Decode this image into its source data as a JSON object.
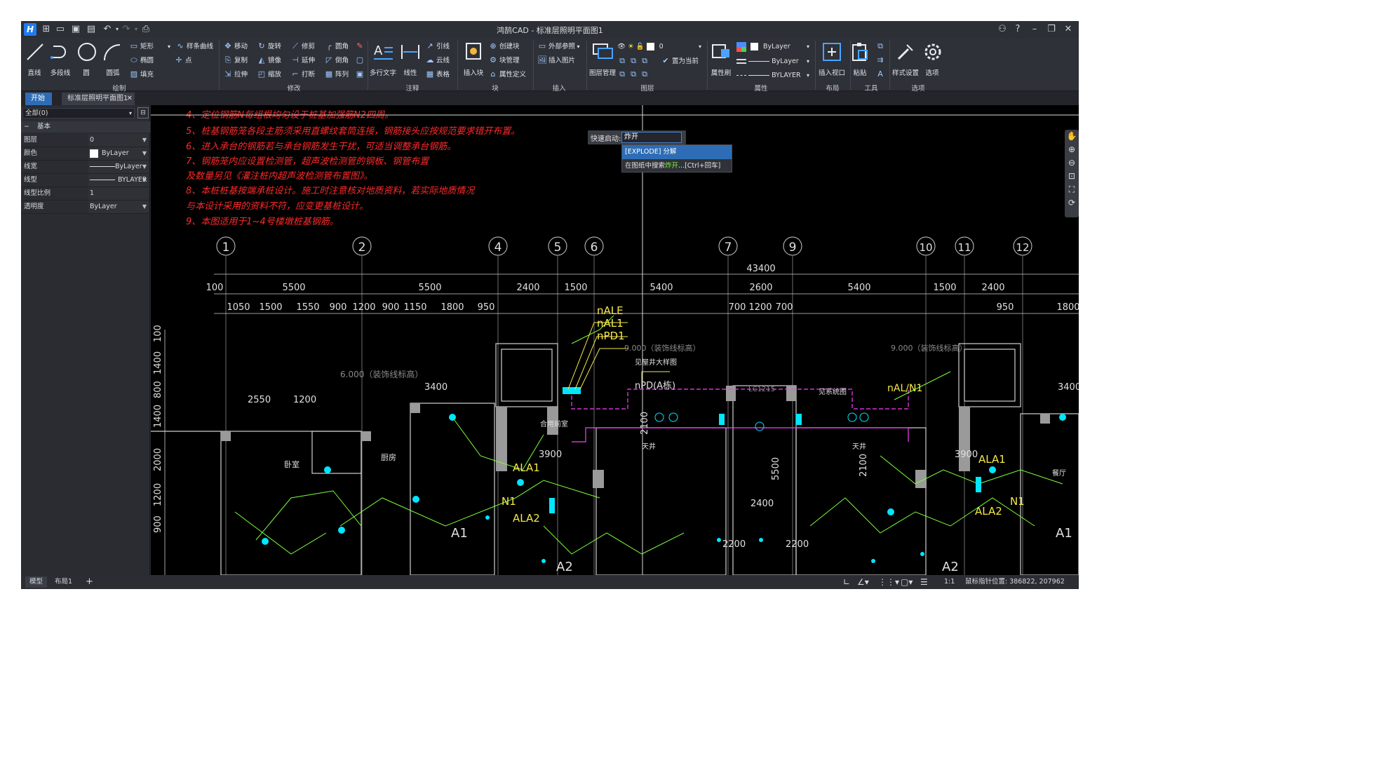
{
  "titlebar": {
    "title": "鸿鹄CAD - 标准层照明平面图1",
    "logo": "H",
    "qat_icons": [
      "new-icon",
      "open-icon",
      "save-icon",
      "save-as-icon",
      "undo-icon",
      "redo-icon",
      "print-icon"
    ]
  },
  "ribbon": {
    "draw": {
      "label": "绘制",
      "line": "直线",
      "polyline": "多段线",
      "circle": "圆",
      "arc": "圆弧",
      "rect": "矩形",
      "ellipse": "椭圆",
      "hatch": "填充",
      "spline": "样条曲线",
      "point": "点"
    },
    "modify": {
      "label": "修改",
      "move": "移动",
      "rotate": "旋转",
      "trim": "修剪",
      "fillet": "圆角",
      "copy": "复制",
      "mirror": "镜像",
      "extend": "延伸",
      "chamfer": "倒角",
      "stretch": "拉伸",
      "scale": "缩放",
      "break": "打断",
      "array": "阵列"
    },
    "annotate": {
      "label": "注释",
      "mtext": "多行文字",
      "dim": "线性",
      "leader": "引线",
      "revcloud": "云线",
      "table": "表格"
    },
    "block": {
      "label": "块",
      "insert": "插入块",
      "create": "创建块",
      "manage": "块管理",
      "attdef": "属性定义"
    },
    "insert": {
      "label": "插入",
      "xref": "外部参照",
      "image": "插入图片"
    },
    "layer": {
      "label": "图层",
      "manager": "图层管理",
      "current": "0",
      "set_current": "置为当前"
    },
    "properties": {
      "label": "属性",
      "match": "属性刷",
      "color": "ByLayer",
      "lineweight": "ByLayer",
      "linetype": "BYLAYER"
    },
    "layout": {
      "label": "布局",
      "viewport": "插入视口"
    },
    "tools": {
      "label": "工具",
      "paste": "粘贴"
    },
    "options": {
      "label": "选项",
      "style": "样式设置",
      "options": "选项"
    }
  },
  "tabs": {
    "home": "开始",
    "doc": "标准层照明平面图1"
  },
  "left_panel": {
    "selector": "全部(0)",
    "section": "基本",
    "rows": [
      {
        "key": "图层",
        "value": "0"
      },
      {
        "key": "颜色",
        "value": "ByLayer"
      },
      {
        "key": "线宽",
        "value": "ByLayer"
      },
      {
        "key": "线型",
        "value": "BYLAYER"
      },
      {
        "key": "线型比例",
        "value": "1"
      },
      {
        "key": "透明度",
        "value": "ByLayer"
      }
    ]
  },
  "quick_launch": {
    "label": "快速启动:",
    "input": "炸开",
    "suggestion": "[EXPLODE] 分解",
    "search_prefix": "在图纸中搜索",
    "search_term": "炸开",
    "search_suffix": "...[Ctrl+回车]"
  },
  "drawing": {
    "notes": [
      "4、定位钢筋N每组根均匀设于桩基加强筋N2四周。",
      "5、桩基钢筋笼各段主筋须采用直螺纹套筒连接，钢筋接头应按规范要求错开布置。",
      "6、进入承台的钢筋若与承台钢筋发生干扰，可适当调整承台钢筋。",
      "7、钢筋笼内应设置检测管，超声波检测管的钢板、钢管布置",
      " 及数量另见《灌注桩内超声波检测管布置图》。",
      "8、本桩桩基按端承桩设计。施工时注意核对地质资料，若实际地质情况",
      "与本设计采用的资料不符，应变更基桩设计。",
      "9、本图适用于1~4号楼墩桩基钢筋。"
    ],
    "axes": [
      "1",
      "2",
      "4",
      "5",
      "6",
      "7",
      "9",
      "10",
      "11",
      "12"
    ],
    "total_dim": "43400",
    "dims_row1": [
      "100",
      "5500",
      "5500",
      "2400",
      "1500",
      "5400",
      "2600",
      "5400",
      "1500",
      "2400"
    ],
    "dims_row2": [
      "1050",
      "1500",
      "1550",
      "900",
      "1200",
      "900",
      "1150",
      "1800",
      "950",
      "700",
      "1200",
      "700",
      "950",
      "1800"
    ],
    "vert_dims": [
      "100",
      "1400",
      "800",
      "1400",
      "2000",
      "1200",
      "900"
    ],
    "labels": [
      "nALE",
      "nAL1",
      "nPD1",
      "9.000（装饰线标高）",
      "6.000（装饰线标高）",
      "见屋井大样图",
      "nPD(A栋)",
      "见系统图",
      "nAL/N1",
      "9.000（装饰线标高）",
      "3400",
      "3400",
      "2550",
      "1200",
      "A1",
      "A2",
      "A1",
      "A2",
      "ALA1",
      "ALA2",
      "ALA1",
      "ALA2",
      "N1",
      "N1",
      "3900",
      "3900",
      "天井",
      "天井",
      "厨房",
      "卧室",
      "餐厅",
      "合用前室",
      "2400",
      "2200",
      "2200",
      "5500",
      "2100",
      "2100",
      "LC1215"
    ]
  },
  "statusbar": {
    "tab_model": "模型",
    "tab_layout": "布局1",
    "add": "+",
    "scale": "1:1",
    "coords": "鼠标指针位置: 386822, 207962"
  },
  "colors": {
    "accent": "#2e6db5",
    "canvas": "#000000",
    "red_text": "#ff2a2a",
    "cyan": "#00e6ff",
    "green": "#7cff3a",
    "magenta": "#ff3cff",
    "yellow": "#f5e84a"
  }
}
